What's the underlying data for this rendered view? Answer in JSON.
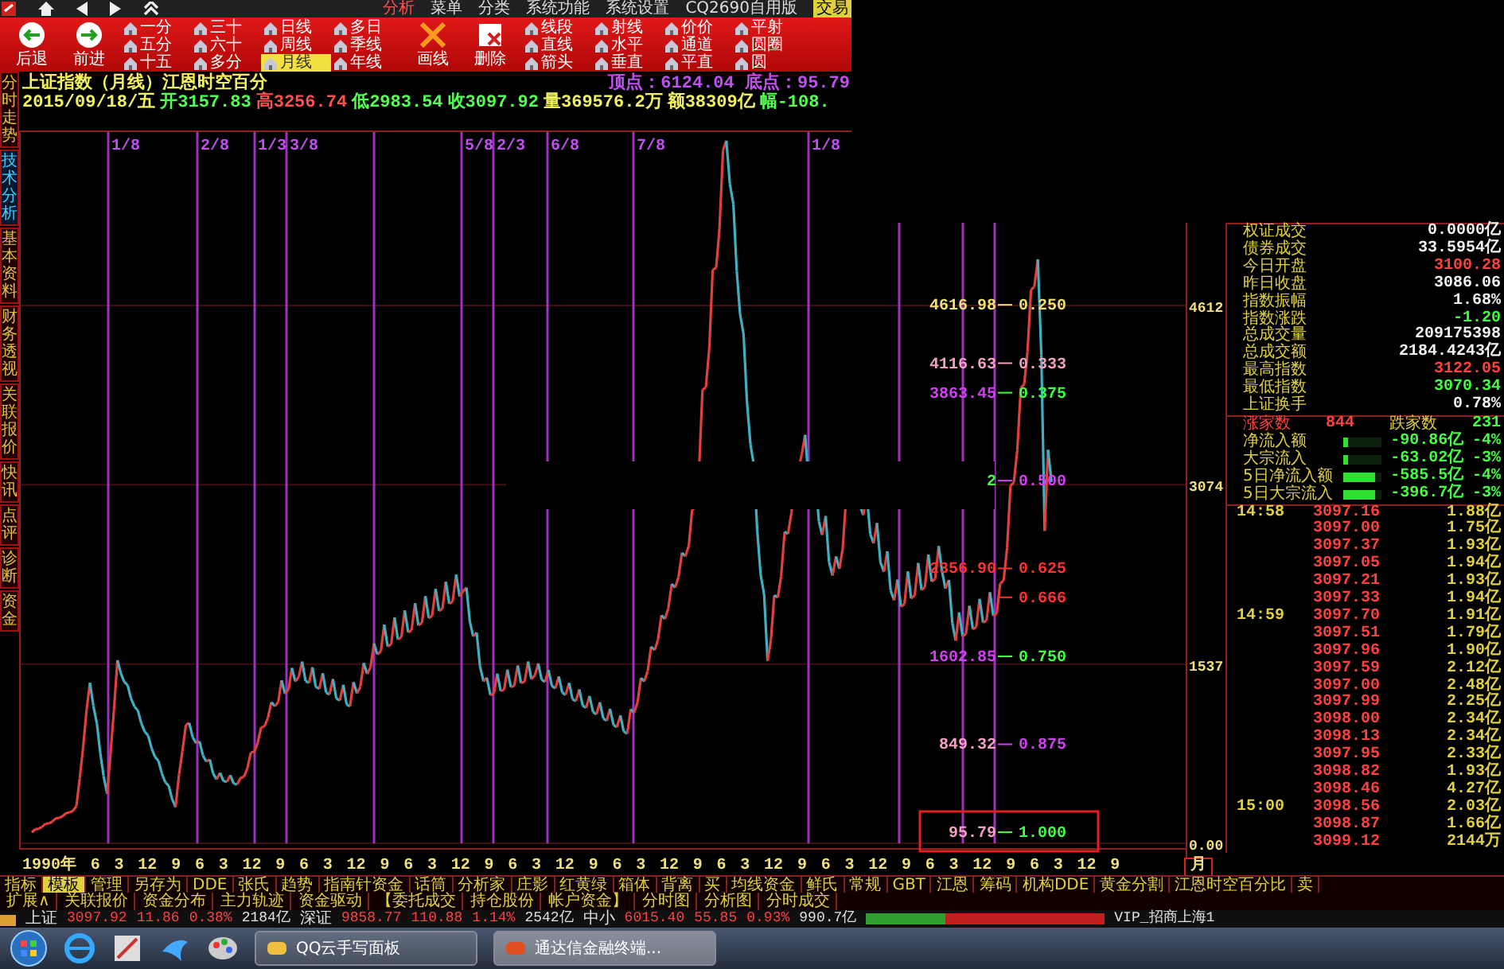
{
  "top_bar": {
    "menu": [
      {
        "label": "分析",
        "selected": true
      },
      {
        "label": "菜单",
        "selected": false
      },
      {
        "label": "分类",
        "selected": false
      },
      {
        "label": "系统功能",
        "selected": false
      },
      {
        "label": "系统设置",
        "selected": false
      },
      {
        "label": "CQ2690自用版",
        "selected": false
      },
      {
        "label": "交易",
        "selected": false,
        "kind": "trade"
      }
    ]
  },
  "toolbar": {
    "nav": [
      {
        "label": "后退",
        "kind": "back"
      },
      {
        "label": "前进",
        "kind": "forward"
      }
    ],
    "periods": [
      {
        "label": "一分",
        "selected": false
      },
      {
        "label": "五分",
        "selected": false
      },
      {
        "label": "十五",
        "selected": false
      },
      {
        "label": "三十",
        "selected": false
      },
      {
        "label": "六十",
        "selected": false
      },
      {
        "label": "多分",
        "selected": false
      },
      {
        "label": "日线",
        "selected": false
      },
      {
        "label": "周线",
        "selected": false
      },
      {
        "label": "月线",
        "selected": true
      },
      {
        "label": "多日",
        "selected": false
      },
      {
        "label": "季线",
        "selected": false
      },
      {
        "label": "年线",
        "selected": false
      }
    ],
    "actions": [
      {
        "label": "画线",
        "kind": "draw"
      },
      {
        "label": "删除",
        "kind": "delete"
      }
    ],
    "tools": [
      "线段",
      "直线",
      "箭头",
      "射线",
      "水平",
      "垂直",
      "价价",
      "通道",
      "平直",
      "平射",
      "圆圈",
      "圆"
    ]
  },
  "chart_header": {
    "title": "上证指数（月线）江恩时空百分",
    "extremes": "顶点：6124.04 底点：95.79",
    "fields": [
      {
        "text": "2015/09/18/五",
        "color": "#f0f060"
      },
      {
        "text": "开3157.83",
        "color": "#50ff50"
      },
      {
        "text": "高3256.74",
        "color": "#ff5050"
      },
      {
        "text": "低2983.54",
        "color": "#50ff50"
      },
      {
        "text": "收3097.92",
        "color": "#50ff50"
      },
      {
        "text": "量369576.2万",
        "color": "#f0f060"
      },
      {
        "text": "额38309亿",
        "color": "#f0f060"
      },
      {
        "text": "幅-108.",
        "color": "#50ff50"
      }
    ]
  },
  "side_tabs": [
    {
      "label": "分时走势",
      "selected": false
    },
    {
      "label": "技术分析",
      "selected": true
    },
    {
      "label": "基本资料",
      "selected": false
    },
    {
      "label": "财务透视",
      "selected": false
    },
    {
      "label": "关联报价",
      "selected": false
    },
    {
      "label": "快讯",
      "selected": false
    },
    {
      "label": "点评",
      "selected": false
    },
    {
      "label": "诊断",
      "selected": false
    },
    {
      "label": "资金",
      "selected": false
    }
  ],
  "chart": {
    "cycle_labels": [
      "1/8",
      "2/8",
      "1/3",
      "3/8",
      "5/8",
      "2/3",
      "6/8",
      "7/8",
      "1/8"
    ],
    "levels": [
      {
        "price": {
          "text": "4616.98",
          "color": "#f0e070"
        },
        "ratio": {
          "text": "0.250",
          "color": "#f0e070"
        },
        "boxed": false
      },
      {
        "price": {
          "text": "4116.63",
          "color": "#f0a0c0"
        },
        "ratio": {
          "text": "0.333",
          "color": "#f0a0c0"
        },
        "boxed": false
      },
      {
        "price": {
          "text": "3863.45",
          "color": "#d040f0"
        },
        "ratio": {
          "text": "0.375",
          "color": "#40ff40"
        },
        "boxed": false
      },
      {
        "price": {
          "text": "2",
          "color": "#40ff40"
        },
        "ratio": {
          "text": "0.500",
          "color": "#d040f0"
        },
        "boxed": false
      },
      {
        "price": {
          "text": "2356.90",
          "color": "#ff3030"
        },
        "ratio": {
          "text": "0.625",
          "color": "#ff3030"
        },
        "boxed": false
      },
      {
        "ratio": {
          "text": "0.666",
          "color": "#ff3030"
        },
        "boxed": false
      },
      {
        "price": {
          "text": "1602.85",
          "color": "#d040f0"
        },
        "ratio": {
          "text": "0.750",
          "color": "#40ff40"
        },
        "boxed": false
      },
      {
        "price": {
          "text": "849.32",
          "color": "#f0a0c0"
        },
        "ratio": {
          "text": "0.875",
          "color": "#d040f0"
        },
        "boxed": false
      },
      {
        "price": {
          "text": "95.79",
          "color": "#f0a0c0"
        },
        "ratio": {
          "text": "1.000",
          "color": "#40ff40"
        },
        "boxed": true
      }
    ],
    "axis_labels": [
      "4612",
      "3074",
      "1537",
      "0.00"
    ],
    "x_labels": [
      "1990年",
      "6",
      "3",
      "12",
      "9",
      "6",
      "3",
      "12",
      "9",
      "6",
      "3",
      "12",
      "9",
      "6",
      "3",
      "12",
      "9",
      "6",
      "3",
      "12",
      "9",
      "6",
      "3",
      "12",
      "9",
      "6",
      "3",
      "12",
      "9",
      "6",
      "3",
      "12",
      "9",
      "6",
      "3",
      "12",
      "9",
      "6",
      "3",
      "12",
      "9"
    ],
    "period": "月"
  },
  "info": {
    "stats": [
      {
        "label": "权证成交",
        "value": "0.0000亿",
        "color": "#f0f0f0"
      },
      {
        "label": "债券成交",
        "value": "33.5954亿",
        "color": "#f0f0f0"
      },
      {
        "label": "今日开盘",
        "value": "3100.28",
        "color": "#ff4040"
      },
      {
        "label": "昨日收盘",
        "value": "3086.06",
        "color": "#f0f0f0"
      },
      {
        "label": "指数振幅",
        "value": "1.68%",
        "color": "#f0f0f0"
      },
      {
        "label": "指数涨跌",
        "value": "-1.20",
        "color": "#40ff40"
      },
      {
        "label": "总成交量",
        "value": "209175398",
        "color": "#f0f0f0"
      },
      {
        "label": "总成交额",
        "value": "2184.4243亿",
        "color": "#f0f0f0"
      },
      {
        "label": "最高指数",
        "value": "3122.05",
        "color": "#ff4040"
      },
      {
        "label": "最低指数",
        "value": "3070.34",
        "color": "#40ff40"
      },
      {
        "label": "上证换手",
        "value": "0.78%",
        "color": "#f0f0f0"
      }
    ],
    "breadth": {
      "up_label": "涨家数",
      "up": "844",
      "down_label": "跌家数",
      "down": "231"
    },
    "flows": [
      {
        "label": "净流入额",
        "level": 0.1,
        "value": "-90.86亿",
        "pct": "-4%"
      },
      {
        "label": "大宗流入",
        "level": 0.1,
        "value": "-63.02亿",
        "pct": "-3%"
      },
      {
        "label": "5日净流入额",
        "level": 0.8,
        "value": "-585.5亿",
        "pct": "-4%"
      },
      {
        "label": "5日大宗流入",
        "level": 0.8,
        "value": "-396.7亿",
        "pct": "-3%"
      }
    ],
    "ticks": [
      {
        "time": "14:58",
        "price": "3097.16",
        "volume": "1.88亿"
      },
      {
        "price": "3097.00",
        "volume": "1.75亿"
      },
      {
        "price": "3097.37",
        "volume": "1.93亿"
      },
      {
        "price": "3097.05",
        "volume": "1.94亿"
      },
      {
        "price": "3097.21",
        "volume": "1.93亿"
      },
      {
        "price": "3097.33",
        "volume": "1.94亿"
      },
      {
        "time": "14:59",
        "price": "3097.70",
        "volume": "1.91亿"
      },
      {
        "price": "3097.51",
        "volume": "1.79亿"
      },
      {
        "price": "3097.96",
        "volume": "1.90亿"
      },
      {
        "price": "3097.59",
        "volume": "2.12亿"
      },
      {
        "price": "3097.00",
        "volume": "2.48亿"
      },
      {
        "price": "3097.99",
        "volume": "2.25亿"
      },
      {
        "price": "3098.00",
        "volume": "2.34亿"
      },
      {
        "price": "3098.13",
        "volume": "2.34亿"
      },
      {
        "price": "3097.95",
        "volume": "2.33亿"
      },
      {
        "price": "3098.82",
        "volume": "1.93亿"
      },
      {
        "price": "3098.46",
        "volume": "4.27亿"
      },
      {
        "time": "15:00",
        "price": "3098.56",
        "volume": "2.03亿"
      },
      {
        "price": "3098.87",
        "volume": "1.66亿"
      },
      {
        "price": "3099.12",
        "volume": "2144万"
      }
    ]
  },
  "indicator_tabs": [
    {
      "label": "指标",
      "selected": false
    },
    {
      "label": "模板",
      "selected": true
    },
    {
      "label": "管理",
      "selected": false
    },
    {
      "label": "另存为",
      "selected": false
    },
    {
      "label": "DDE",
      "selected": false
    },
    {
      "label": "张氏",
      "selected": false
    },
    {
      "label": "趋势",
      "selected": false
    },
    {
      "label": "指南针资金",
      "selected": false
    },
    {
      "label": "话筒",
      "selected": false
    },
    {
      "label": "分析家",
      "selected": false
    },
    {
      "label": "庄影",
      "selected": false
    },
    {
      "label": "红黄绿",
      "selected": false
    },
    {
      "label": "箱体",
      "selected": false
    },
    {
      "label": "背离",
      "selected": false
    },
    {
      "label": "买",
      "selected": false
    },
    {
      "label": "均线资金",
      "selected": false
    },
    {
      "label": "鲜氏",
      "selected": false
    },
    {
      "label": "常规",
      "selected": false
    },
    {
      "label": "GBT",
      "selected": false
    },
    {
      "label": "江恩",
      "selected": false
    },
    {
      "label": "筹码",
      "selected": false
    },
    {
      "label": "机构DDE",
      "selected": false
    },
    {
      "label": "黄金分割",
      "selected": false
    },
    {
      "label": "江恩时空百分比",
      "selected": false
    },
    {
      "label": "卖",
      "selected": false
    }
  ],
  "panel_tabs": [
    "扩展∧",
    "关联报价",
    "资金分布",
    "主力轨迹",
    "资金驱动",
    "【委托成交",
    "持仓股份",
    "帐户资金】",
    "分时图",
    "分析图",
    "分时成交"
  ],
  "status_bar": {
    "indices": [
      {
        "label": "上证",
        "value": "3097.92",
        "change": "11.86",
        "pct": "0.38%",
        "amount": "2184亿"
      },
      {
        "label": "深证",
        "value": "9858.77",
        "change": "110.88",
        "pct": "1.14%",
        "amount": "2542亿"
      },
      {
        "label": "中小",
        "value": "6015.40",
        "change": "55.85",
        "pct": "0.93%",
        "amount": "990.7亿"
      }
    ],
    "account": "VIP_招商上海1"
  },
  "taskbar": {
    "tasks": [
      {
        "label": "QQ云手写面板",
        "selected": false
      },
      {
        "label": "通达信金融终端...",
        "selected": true
      }
    ]
  }
}
